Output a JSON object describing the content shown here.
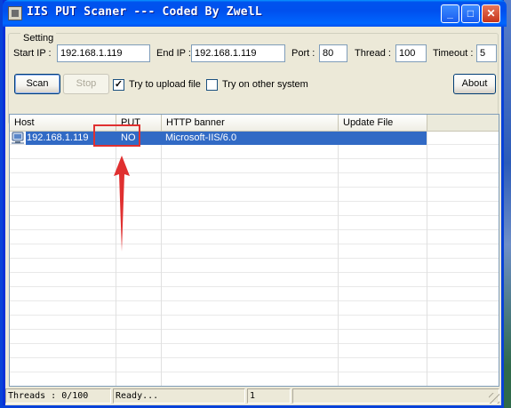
{
  "window": {
    "title": "IIS PUT Scaner --- Coded By ZwelL",
    "minimize_glyph": "_",
    "maximize_glyph": "□",
    "close_glyph": "✕"
  },
  "settings": {
    "group_label": "Setting",
    "start_ip_label": "Start IP :",
    "start_ip_value": "192.168.1.119",
    "end_ip_label": "End IP :",
    "end_ip_value": "192.168.1.119",
    "port_label": "Port :",
    "port_value": "80",
    "thread_label": "Thread :",
    "thread_value": "100",
    "timeout_label": "Timeout :",
    "timeout_value": "5",
    "scan_label": "Scan",
    "stop_label": "Stop",
    "upload_label": "Try to upload file",
    "upload_checked": true,
    "other_system_label": "Try on other system",
    "other_system_checked": false,
    "about_label": "About"
  },
  "table": {
    "columns": [
      "Host",
      "PUT",
      "HTTP banner",
      "Update File"
    ],
    "rows": [
      {
        "host": "192.168.1.119",
        "put": "NO",
        "banner": "Microsoft-IIS/6.0",
        "update_file": ""
      }
    ]
  },
  "statusbar": {
    "threads": "Threads : 0/100",
    "status": "Ready...",
    "count": "1"
  },
  "colors": {
    "selection": "#316ac5",
    "annotation": "#e03030",
    "titlebar": "#0055ea"
  },
  "icons": {
    "row_host": "network-computer-icon",
    "annotation_arrow": "red-arrow-up"
  }
}
